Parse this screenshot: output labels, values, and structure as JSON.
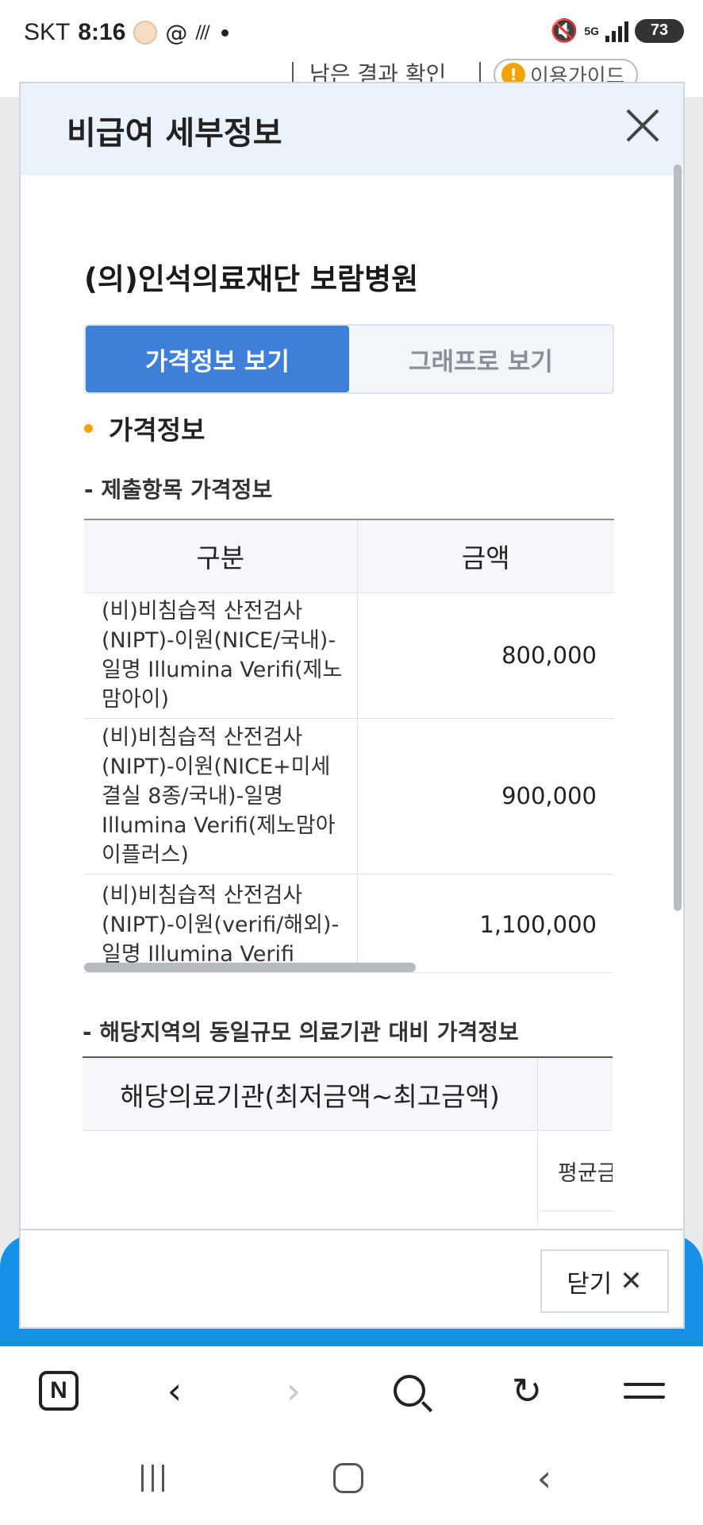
{
  "status_bar": {
    "carrier": "SKT",
    "time": "8:16",
    "network": "5G",
    "battery": "73"
  },
  "background_page": {
    "peek_text": "남은 결과 확인",
    "guide_button": "이용가이드",
    "guide_icon_glyph": "!"
  },
  "modal": {
    "title": "비급여 세부정보",
    "hospital_name": "(의)인석의료재단 보람병원",
    "tabs": [
      {
        "label": "가격정보 보기",
        "active": true
      },
      {
        "label": "그래프로 보기",
        "active": false
      }
    ],
    "section_title": "가격정보",
    "submitted_items": {
      "subtitle": "- 제출항목 가격정보",
      "headers": {
        "category": "구분",
        "amount": "금액"
      },
      "rows": [
        {
          "item": "(비)비침습적 산전검사(NIPT)-이원(NICE/국내)-일명 Illumina Verifi(제노맘아이)",
          "amount": "800,000"
        },
        {
          "item": "(비)비침습적 산전검사(NIPT)-이원(NICE+미세결실 8종/국내)-일명 Illumina Verifi(제노맘아이플러스)",
          "amount": "900,000"
        },
        {
          "item": "(비)비침습적 산전검사(NIPT)-이원(verifi/해외)-일명 Illumina Verifi",
          "amount": "1,100,000"
        }
      ]
    },
    "region_compare": {
      "subtitle": "- 해당지역의 동일규모 의료기관 대비 가격정보",
      "header_left": "해당의료기관(최저금액~최고금액)",
      "avg_label": "평균금"
    },
    "footer": {
      "close_label": "닫기",
      "close_icon": "✕"
    }
  },
  "browser_toolbar": {
    "home_logo": "N",
    "back_glyph": "‹",
    "forward_glyph": "›",
    "reload_glyph": "↻"
  },
  "system_nav": {
    "back_glyph": "‹"
  },
  "colors": {
    "accent_blue": "#3d7fd9",
    "bullet_orange": "#f3a300",
    "header_bg": "#eaf2fb",
    "band_blue": "#1592e6"
  }
}
